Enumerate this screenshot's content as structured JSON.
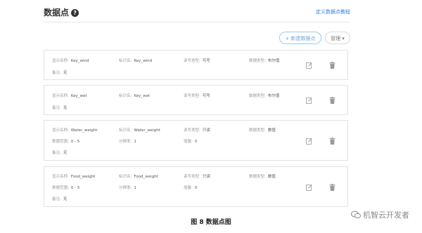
{
  "header": {
    "title": "数据点",
    "help_icon_glyph": "?",
    "doc_link": "定义数据点教程"
  },
  "toolbar": {
    "new_button": "+ 新建数据点",
    "manage_button": "管理 ▾"
  },
  "labels": {
    "display_name": "显示名称:",
    "identifier": "标识名:",
    "rw_type": "读写类型:",
    "data_type": "数据类型:",
    "remark": "备注:",
    "range": "数据范围:",
    "resolution": "分辨率:",
    "increment": "增量:"
  },
  "rows": [
    {
      "display_name": "Key_wind",
      "identifier": "Key_wind",
      "rw_type": "可写",
      "data_type": "布尔值",
      "remark": "无"
    },
    {
      "display_name": "Key_wet",
      "identifier": "Key_wet",
      "rw_type": "可写",
      "data_type": "布尔值",
      "remark": "无"
    },
    {
      "display_name": "Water_weight",
      "identifier": "Water_weight",
      "rw_type": "只读",
      "data_type": "数值",
      "range": "0 - 5",
      "resolution": "1",
      "increment": "0",
      "remark": "无"
    },
    {
      "display_name": "Food_weight",
      "identifier": "Food_weight",
      "rw_type": "只读",
      "data_type": "数值",
      "range": "0 - 5",
      "resolution": "1",
      "increment": "0",
      "remark": "无"
    }
  ],
  "caption": "图 8  数据点图",
  "watermark": "机智云开发者",
  "icons": {
    "edit": "edit-icon",
    "delete": "trash-icon",
    "help": "question-circle-icon",
    "watermark": "wechat-icon"
  },
  "colors": {
    "link": "#2f83d8",
    "card_border": "#e3e3e3",
    "icon": "#999999"
  }
}
